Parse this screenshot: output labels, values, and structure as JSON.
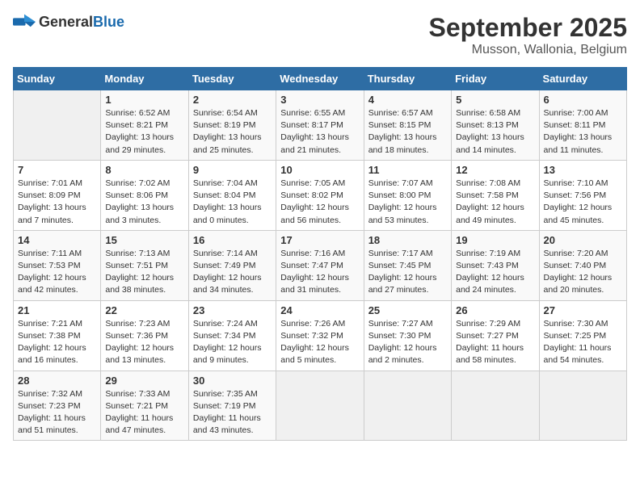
{
  "logo": {
    "text_general": "General",
    "text_blue": "Blue"
  },
  "title": "September 2025",
  "location": "Musson, Wallonia, Belgium",
  "days_of_week": [
    "Sunday",
    "Monday",
    "Tuesday",
    "Wednesday",
    "Thursday",
    "Friday",
    "Saturday"
  ],
  "weeks": [
    [
      {
        "day": "",
        "empty": true
      },
      {
        "day": "1",
        "sunrise": "6:52 AM",
        "sunset": "8:21 PM",
        "daylight": "13 hours and 29 minutes."
      },
      {
        "day": "2",
        "sunrise": "6:54 AM",
        "sunset": "8:19 PM",
        "daylight": "13 hours and 25 minutes."
      },
      {
        "day": "3",
        "sunrise": "6:55 AM",
        "sunset": "8:17 PM",
        "daylight": "13 hours and 21 minutes."
      },
      {
        "day": "4",
        "sunrise": "6:57 AM",
        "sunset": "8:15 PM",
        "daylight": "13 hours and 18 minutes."
      },
      {
        "day": "5",
        "sunrise": "6:58 AM",
        "sunset": "8:13 PM",
        "daylight": "13 hours and 14 minutes."
      },
      {
        "day": "6",
        "sunrise": "7:00 AM",
        "sunset": "8:11 PM",
        "daylight": "13 hours and 11 minutes."
      }
    ],
    [
      {
        "day": "7",
        "sunrise": "7:01 AM",
        "sunset": "8:09 PM",
        "daylight": "13 hours and 7 minutes."
      },
      {
        "day": "8",
        "sunrise": "7:02 AM",
        "sunset": "8:06 PM",
        "daylight": "13 hours and 3 minutes."
      },
      {
        "day": "9",
        "sunrise": "7:04 AM",
        "sunset": "8:04 PM",
        "daylight": "13 hours and 0 minutes."
      },
      {
        "day": "10",
        "sunrise": "7:05 AM",
        "sunset": "8:02 PM",
        "daylight": "12 hours and 56 minutes."
      },
      {
        "day": "11",
        "sunrise": "7:07 AM",
        "sunset": "8:00 PM",
        "daylight": "12 hours and 53 minutes."
      },
      {
        "day": "12",
        "sunrise": "7:08 AM",
        "sunset": "7:58 PM",
        "daylight": "12 hours and 49 minutes."
      },
      {
        "day": "13",
        "sunrise": "7:10 AM",
        "sunset": "7:56 PM",
        "daylight": "12 hours and 45 minutes."
      }
    ],
    [
      {
        "day": "14",
        "sunrise": "7:11 AM",
        "sunset": "7:53 PM",
        "daylight": "12 hours and 42 minutes."
      },
      {
        "day": "15",
        "sunrise": "7:13 AM",
        "sunset": "7:51 PM",
        "daylight": "12 hours and 38 minutes."
      },
      {
        "day": "16",
        "sunrise": "7:14 AM",
        "sunset": "7:49 PM",
        "daylight": "12 hours and 34 minutes."
      },
      {
        "day": "17",
        "sunrise": "7:16 AM",
        "sunset": "7:47 PM",
        "daylight": "12 hours and 31 minutes."
      },
      {
        "day": "18",
        "sunrise": "7:17 AM",
        "sunset": "7:45 PM",
        "daylight": "12 hours and 27 minutes."
      },
      {
        "day": "19",
        "sunrise": "7:19 AM",
        "sunset": "7:43 PM",
        "daylight": "12 hours and 24 minutes."
      },
      {
        "day": "20",
        "sunrise": "7:20 AM",
        "sunset": "7:40 PM",
        "daylight": "12 hours and 20 minutes."
      }
    ],
    [
      {
        "day": "21",
        "sunrise": "7:21 AM",
        "sunset": "7:38 PM",
        "daylight": "12 hours and 16 minutes."
      },
      {
        "day": "22",
        "sunrise": "7:23 AM",
        "sunset": "7:36 PM",
        "daylight": "12 hours and 13 minutes."
      },
      {
        "day": "23",
        "sunrise": "7:24 AM",
        "sunset": "7:34 PM",
        "daylight": "12 hours and 9 minutes."
      },
      {
        "day": "24",
        "sunrise": "7:26 AM",
        "sunset": "7:32 PM",
        "daylight": "12 hours and 5 minutes."
      },
      {
        "day": "25",
        "sunrise": "7:27 AM",
        "sunset": "7:30 PM",
        "daylight": "12 hours and 2 minutes."
      },
      {
        "day": "26",
        "sunrise": "7:29 AM",
        "sunset": "7:27 PM",
        "daylight": "11 hours and 58 minutes."
      },
      {
        "day": "27",
        "sunrise": "7:30 AM",
        "sunset": "7:25 PM",
        "daylight": "11 hours and 54 minutes."
      }
    ],
    [
      {
        "day": "28",
        "sunrise": "7:32 AM",
        "sunset": "7:23 PM",
        "daylight": "11 hours and 51 minutes."
      },
      {
        "day": "29",
        "sunrise": "7:33 AM",
        "sunset": "7:21 PM",
        "daylight": "11 hours and 47 minutes."
      },
      {
        "day": "30",
        "sunrise": "7:35 AM",
        "sunset": "7:19 PM",
        "daylight": "11 hours and 43 minutes."
      },
      {
        "day": "",
        "empty": true
      },
      {
        "day": "",
        "empty": true
      },
      {
        "day": "",
        "empty": true
      },
      {
        "day": "",
        "empty": true
      }
    ]
  ]
}
